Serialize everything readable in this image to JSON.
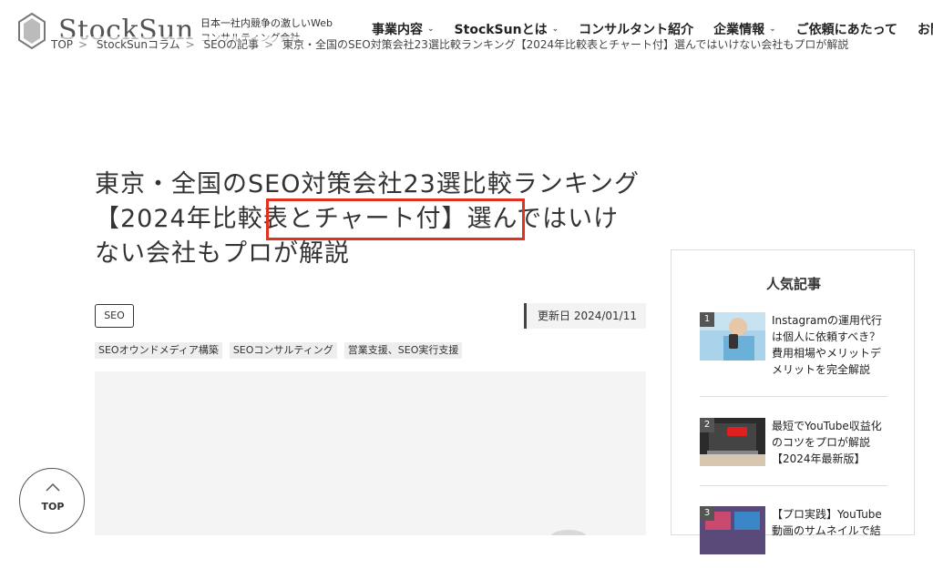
{
  "header": {
    "logo_text": "StockSun",
    "tagline": "日本一社内競争の激しいWebコンサルティング会社",
    "nav": [
      {
        "label": "事業内容"
      },
      {
        "label": "StockSunとは"
      },
      {
        "label": "コンサルタント紹介"
      },
      {
        "label": "企業情報"
      },
      {
        "label": "ご依頼にあたって"
      },
      {
        "label": "お問"
      }
    ]
  },
  "breadcrumb": [
    "TOP",
    "StockSunコラム",
    "SEOの記事",
    "東京・全国のSEO対策会社23選比較ランキング【2024年比較表とチャート付】選んではいけない会社もプロが解説"
  ],
  "article": {
    "title": "東京・全国のSEO対策会社23選比較ランキング【2024年比較表とチャート付】選んではいけない会社もプロが解説",
    "category": "SEO",
    "updated": "更新日 2024/01/11",
    "tags": [
      "SEOオウンドメディア構築",
      "SEOコンサルティング",
      "営業支援、SEO実行支援"
    ]
  },
  "sidebar": {
    "title": "人気記事",
    "posts": [
      {
        "num": "1",
        "title": "Instagramの運用代行は個人に依頼すべき？費用相場やメリットデメリットを完全解説"
      },
      {
        "num": "2",
        "title": "最短でYouTube収益化のコツをプロが解説【2024年最新版】"
      },
      {
        "num": "3",
        "title": "【プロ実践】YouTube動画のサムネイルで結"
      }
    ]
  },
  "top_button": {
    "label": "TOP"
  },
  "colors": {
    "highlight": "#e0321e",
    "text": "#333333"
  }
}
